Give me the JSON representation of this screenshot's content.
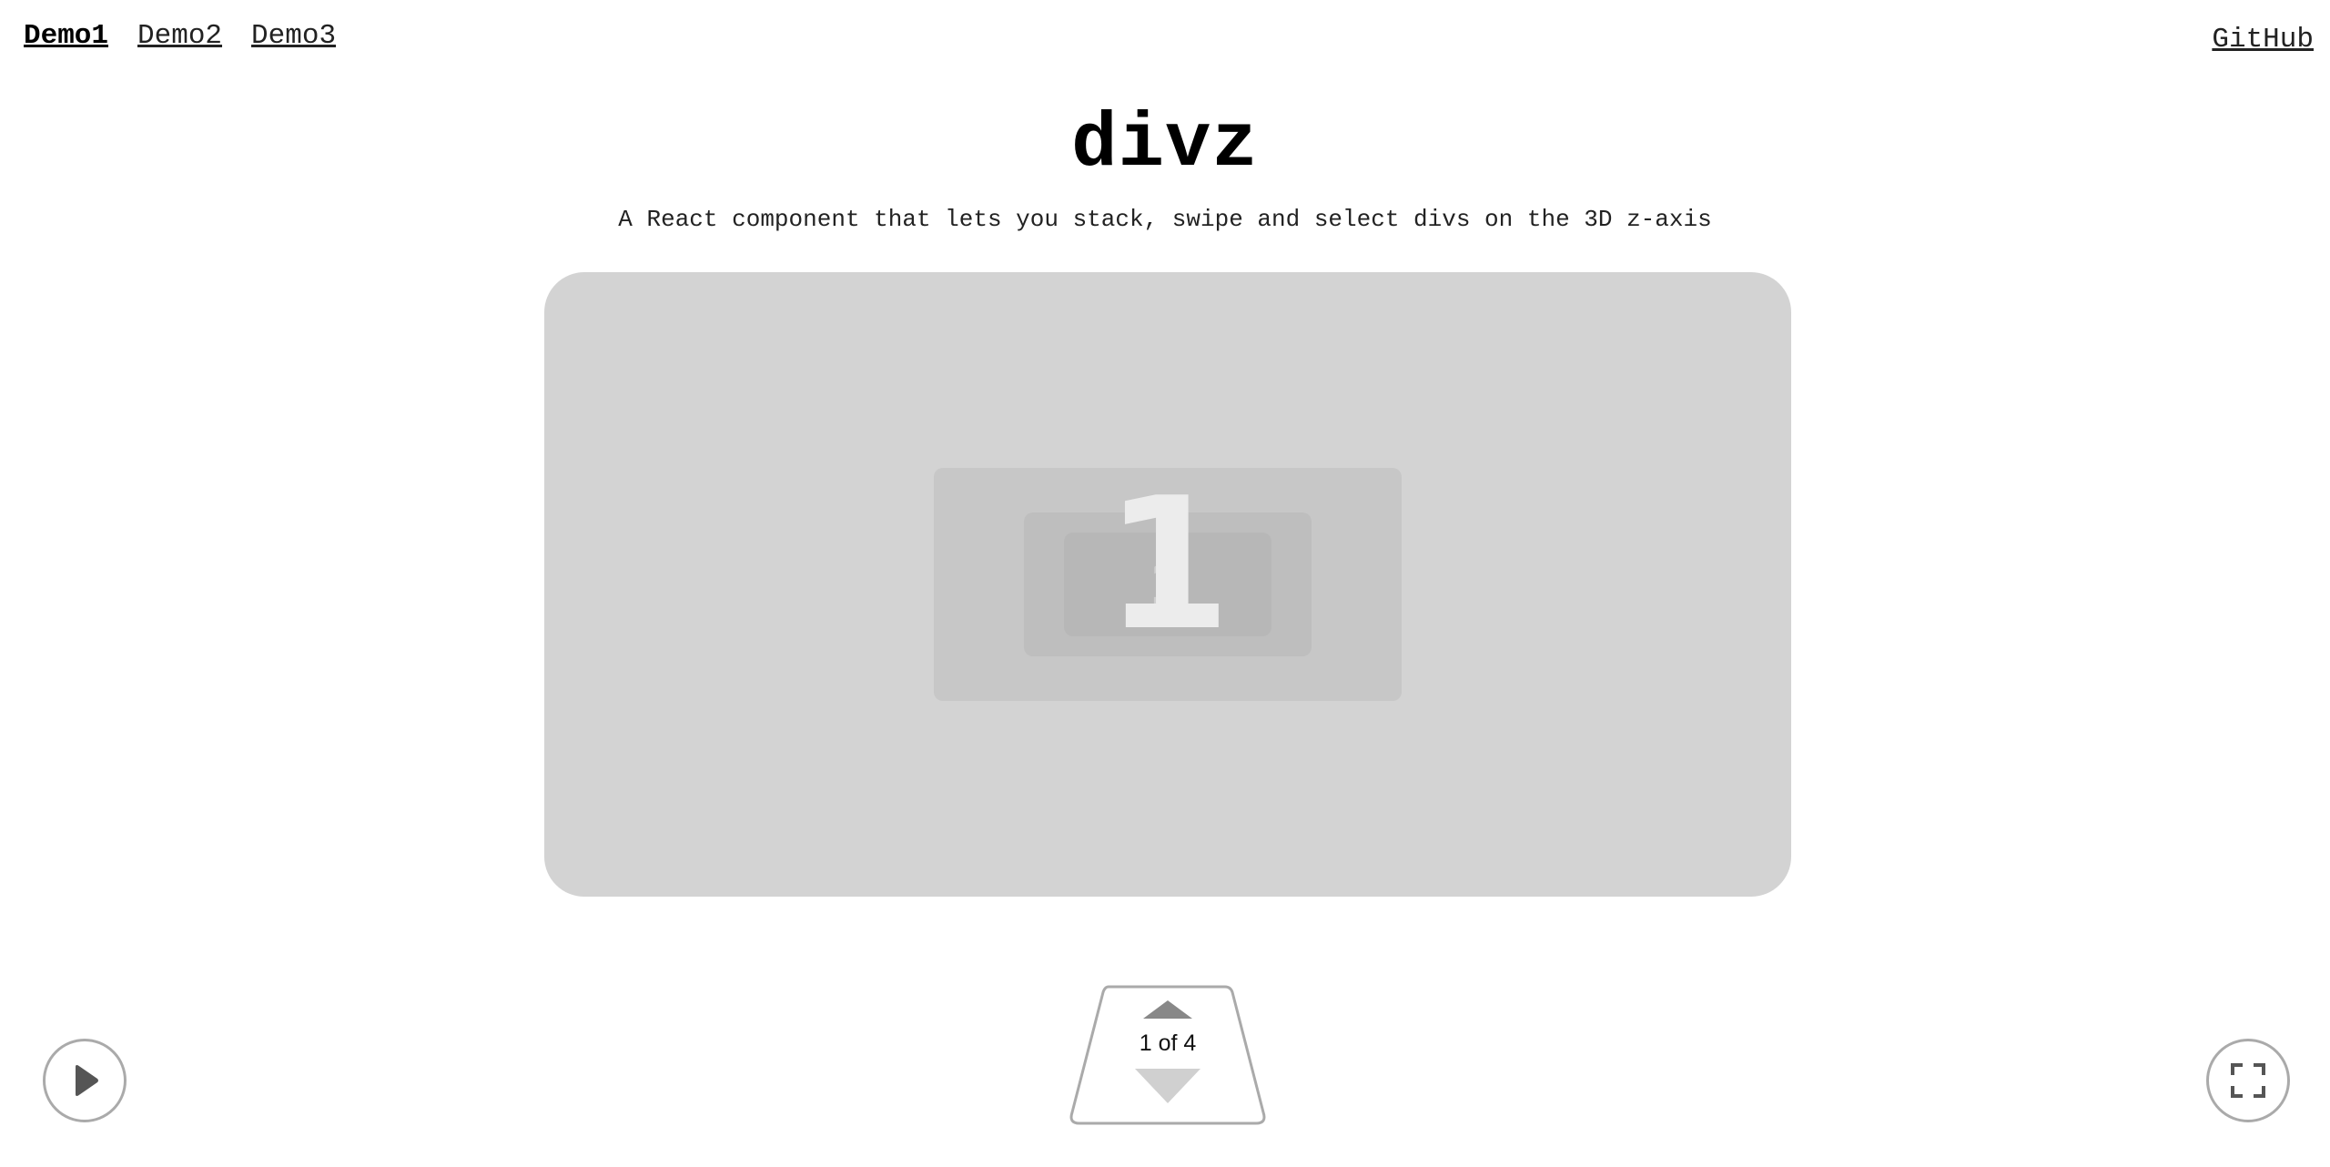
{
  "nav": {
    "items": [
      {
        "label": "Demo1",
        "active": true
      },
      {
        "label": "Demo2",
        "active": false
      },
      {
        "label": "Demo3",
        "active": false
      }
    ],
    "github_label": "GitHub"
  },
  "header": {
    "title": "divz",
    "subtitle": "A React component that lets you stack, swipe and select divs on the 3D z-axis"
  },
  "stage": {
    "current_card_label": "1",
    "behind_card_label": "1"
  },
  "controls": {
    "play_icon": "play-icon",
    "fullscreen_icon": "fullscreen-icon",
    "pager_label": "1 of 4"
  },
  "colors": {
    "stage_bg": "#d3d3d3",
    "arrow_up": "#888888",
    "arrow_down": "#d0d0d0",
    "button_border": "#aaaaaa"
  }
}
